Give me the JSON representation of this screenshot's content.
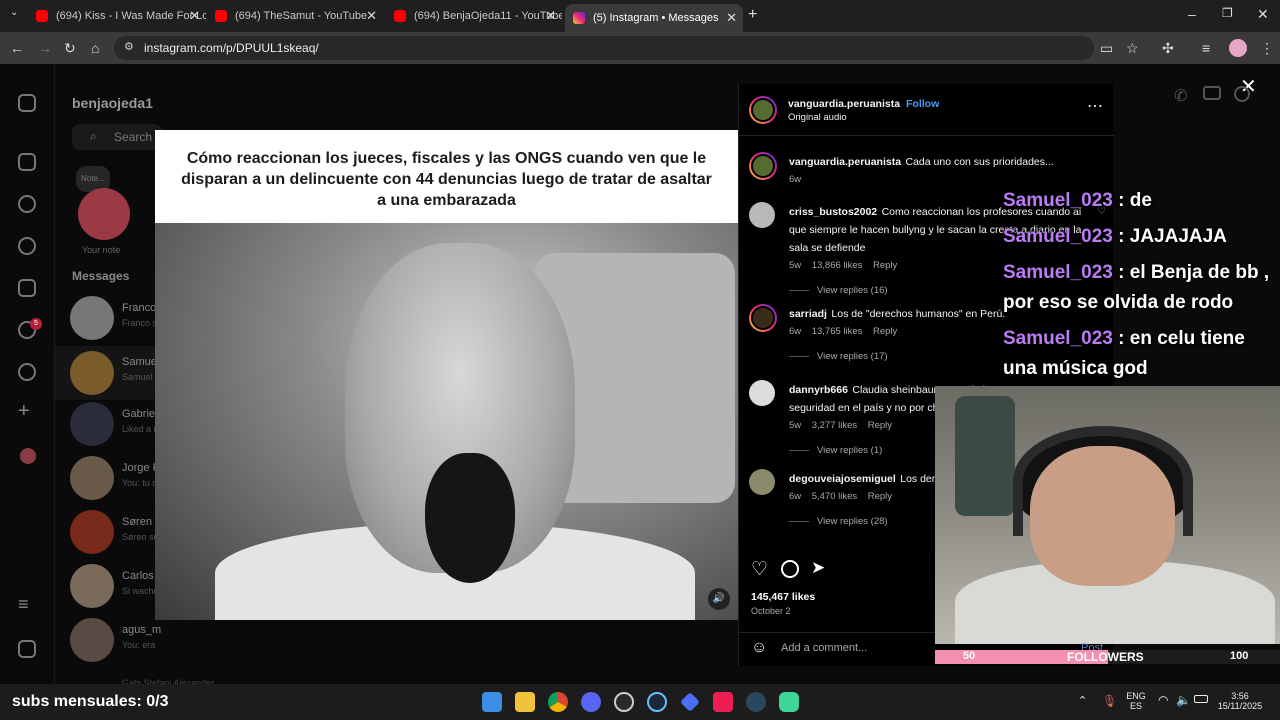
{
  "browser": {
    "tabs": [
      {
        "title": "(694) Kiss - I Was Made For Lov",
        "icon": "youtube-icon"
      },
      {
        "title": "(694) TheSamut - YouTube",
        "icon": "youtube-icon"
      },
      {
        "title": "(694) BenjaOjeda11 - YouTube",
        "icon": "youtube-icon"
      },
      {
        "title": "(5) Instagram • Messages",
        "icon": "instagram-icon"
      }
    ],
    "url": "instagram.com/p/DPUUL1skeaq/"
  },
  "instagram": {
    "profile_name": "benjaojeda1",
    "search_placeholder": "Search",
    "note_label": "Note...",
    "your_note": "Your note",
    "messages_heading": "Messages",
    "notification_badge": "5",
    "conversations": [
      {
        "name": "Franco",
        "snippet": "Franco s"
      },
      {
        "name": "Samue",
        "snippet": "Samuel"
      },
      {
        "name": "Gabrie",
        "snippet": "Liked a r"
      },
      {
        "name": "Jorge F",
        "snippet": "You: tu r"
      },
      {
        "name": "Søren",
        "snippet": "Søren se"
      },
      {
        "name": "Carlos",
        "snippet": "Si wachu"
      },
      {
        "name": "agus_m",
        "snippet": "You: era"
      }
    ],
    "last_conversation_partial": "Gabi Stefani Alexander"
  },
  "post": {
    "video_caption": "Cómo reaccionan los jueces, fiscales y las ONGS cuando ven que le disparan a un delincuente con 44 denuncias luego de tratar de asaltar a una embarazada",
    "author": "vanguardia.peruanista",
    "separator": "•",
    "follow_label": "Follow",
    "audio": "Original audio",
    "caption": "Cada uno con sus prioridades...",
    "caption_age": "6w",
    "likes": "145,467 likes",
    "date": "October 2",
    "add_comment_placeholder": "Add a comment...",
    "post_label": "Post",
    "comments": [
      {
        "user": "criss_bustos2002",
        "text": "Como reaccionan los profesores cuando al que siempre le hacen bullyng y le sacan la cresta a diario en la sala se defiende",
        "age": "5w",
        "likes": "13,866 likes",
        "reply": "Reply",
        "view_replies": "View replies (16)"
      },
      {
        "user": "sarriadj",
        "text": "Los de \"derechos humanos\" en Perú.",
        "age": "6w",
        "likes": "13,765 likes",
        "reply": "Reply",
        "view_replies": "View replies (17)"
      },
      {
        "user": "dannyrb666",
        "text": "Claudia sheinbaum cuando le preguntan por seguridad en el país y no por ch",
        "age": "5w",
        "likes": "3,277 likes",
        "reply": "Reply",
        "view_replies": "View replies (1)"
      },
      {
        "user": "degouveiajosemiguel",
        "text": "Los derec humanos.",
        "age": "6w",
        "likes": "5,470 likes",
        "reply": "Reply",
        "view_replies": "View replies (28)"
      }
    ]
  },
  "stream_overlay": {
    "chat": [
      {
        "user": "Samuel_023",
        "sep": " : ",
        "message": "de"
      },
      {
        "user": "Samuel_023",
        "sep": " : ",
        "message": "JAJAJAJA"
      },
      {
        "user": "Samuel_023",
        "sep": " : ",
        "message": "el Benja de bb ,"
      },
      {
        "cont": "por eso se olvida de rodo"
      },
      {
        "user": "Samuel_023",
        "sep": " : ",
        "message": "en celu tiene"
      },
      {
        "cont": "una música god"
      }
    ],
    "followers_goal": {
      "current": "50",
      "label": "FOLLOWERS",
      "target": "100",
      "fraction": 0.5
    },
    "subs_text": "subs mensuales: 0/3"
  },
  "taskbar": {
    "lang": "ENG",
    "region": "ES",
    "time": "3:56",
    "date": "15/11/2025"
  }
}
